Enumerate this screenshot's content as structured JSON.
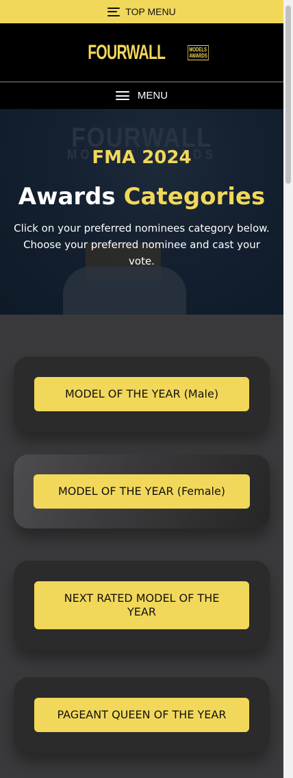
{
  "top_bar": {
    "label": "TOP MENU",
    "icon": "hamburger-icon"
  },
  "logo": {
    "word": "FOURWALL",
    "sub_line1": "MODELS",
    "sub_line2": "AWARDS"
  },
  "menu_bar": {
    "label": "MENU",
    "icon": "hamburger-icon"
  },
  "hero": {
    "watermark_line1": "FOURWALL",
    "watermark_line2": "MODELS AWARDS",
    "eyebrow": "FMA 2024",
    "title_plain": "Awards ",
    "title_accent": "Categories",
    "description": "Click on your preferred nominees category below. Choose your preferred nominee and cast your vote."
  },
  "categories": [
    {
      "label": "MODEL OF THE YEAR (Male)"
    },
    {
      "label": "MODEL OF THE YEAR (Female)"
    },
    {
      "label": "NEXT RATED MODEL OF THE YEAR"
    },
    {
      "label": "PAGEANT QUEEN OF THE YEAR"
    }
  ],
  "colors": {
    "accent": "#f2d85a",
    "hero_bg": "#142030",
    "page_bg": "#3a3a3c"
  }
}
